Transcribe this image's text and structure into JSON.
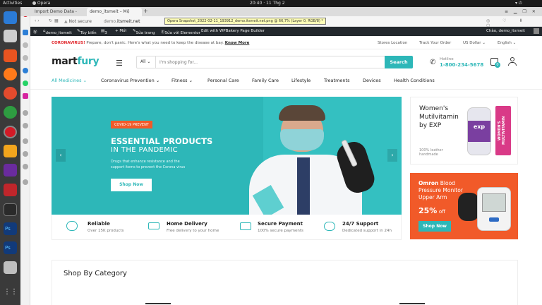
{
  "sysbar": {
    "activities": "Activities",
    "app": "Opera",
    "clock": "20:40 · 11 Thg 2"
  },
  "tabs": [
    {
      "title": "Import Demo Data -"
    },
    {
      "title": "demo_itsmeit – Mộ"
    },
    {
      "title": "+"
    }
  ],
  "address": {
    "security": "Not secure",
    "host": "demo.",
    "domain": "itsmeit.net",
    "snapshot": "Opera Snapshot_2022-02-11_193912_demo.itsmeit.net.png @ 66,7% (Layer 0, RGB/8) *"
  },
  "wpbar": {
    "site": "demo_itsmeit",
    "customize": "Tùy biến",
    "comments": "3",
    "new": "+ Mới",
    "edit": "Sửa trang",
    "elementor": "Sửa với Elementor",
    "wpbakery": "Edit with WPBakery Page Builder",
    "greeting": "Chào, demo_itsmeit"
  },
  "notice": {
    "label": "CORONAVIRUS!",
    "text": " Prepare, don't panic. Here's what you need to keep the disease at bay.",
    "link": "Know More"
  },
  "topmenu": {
    "stores": "Stores Location",
    "track": "Track Your Order",
    "currency": "US Dollar",
    "lang": "English"
  },
  "header": {
    "logo_a": "mart",
    "logo_b": "fury",
    "category": "All",
    "search_placeholder": "I'm shopping for...",
    "search_button": "Search",
    "hotline_label": "Hotline",
    "hotline_number": "1-800-234-5678",
    "cart_count": "0"
  },
  "nav": [
    {
      "label": "All Medicines",
      "dropdown": true
    },
    {
      "label": "Coronavirus Prevention",
      "dropdown": true
    },
    {
      "label": "Fitness",
      "dropdown": true
    },
    {
      "label": "Personal Care",
      "dropdown": false
    },
    {
      "label": "Family Care",
      "dropdown": false
    },
    {
      "label": "Lifestyle",
      "dropdown": false
    },
    {
      "label": "Treatments",
      "dropdown": false
    },
    {
      "label": "Devices",
      "dropdown": false
    },
    {
      "label": "Health Conditions",
      "dropdown": false
    }
  ],
  "hero": {
    "badge": "COVID-19 PREVENT",
    "title": "ESSENTIAL PRODUCTS",
    "subtitle": "IN THE PANDEMIC",
    "desc1": "Drugs that enhance resistance and the",
    "desc2": "support items to prevent the Corona virus",
    "button": "Shop Now"
  },
  "ad1": {
    "line1": "Women's",
    "line2": "Mutilvitamin",
    "line3": "by EXP",
    "small1": "100% leather",
    "small2": "handmade",
    "bottle_brand": "exp",
    "box_text": "WOMEN'S MULTIVITAMIN"
  },
  "ad2": {
    "brand": "Omron",
    "line1": " Blood",
    "line2": "Pressure Monitor",
    "line3": "Upper Arm",
    "percent": "25%",
    "off": "off",
    "button": "Shop Now"
  },
  "features": [
    {
      "title": "Reliable",
      "sub": "Over 15K products"
    },
    {
      "title": "Home Delivery",
      "sub": "Free delivery to your home"
    },
    {
      "title": "Secure Payment",
      "sub": "100% secure payments"
    },
    {
      "title": "24/7 Support",
      "sub": "Dedicated support in 24h"
    }
  ],
  "section": {
    "title": "Shop By Category"
  },
  "colors": {
    "brand": "#2db7b8",
    "accent": "#f15a29",
    "logo_fury": "#2db7b8"
  }
}
